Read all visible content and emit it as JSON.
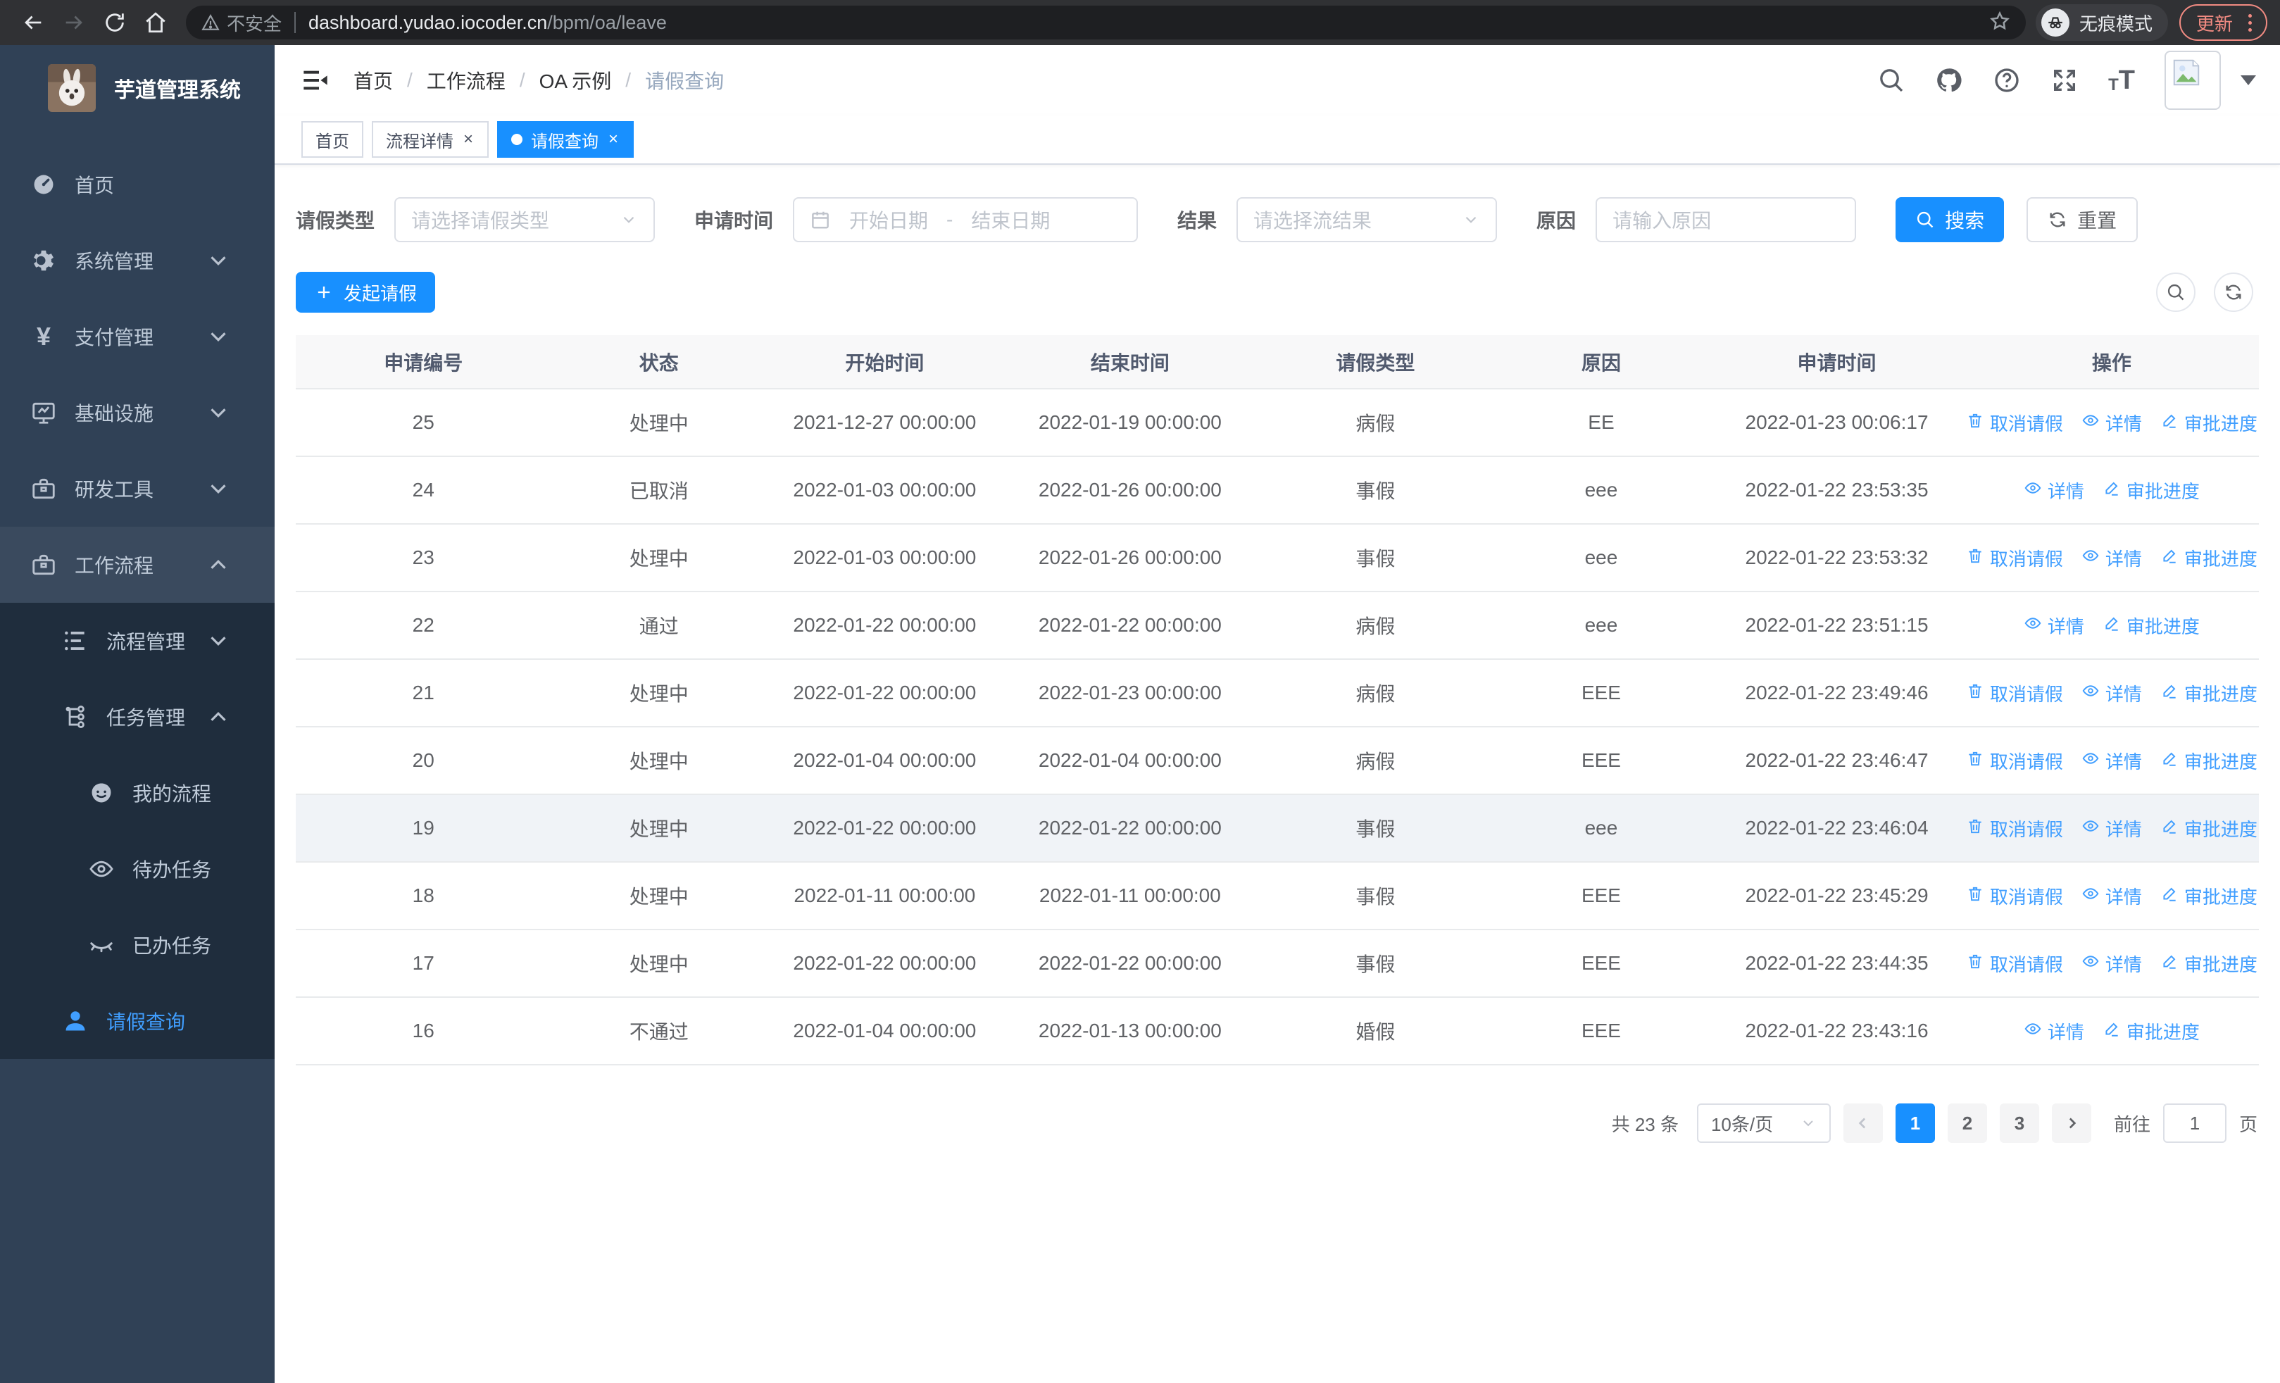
{
  "browser": {
    "security_label": "不安全",
    "url_host": "dashboard.yudao.iocoder.cn",
    "url_path": "/bpm/oa/leave",
    "incognito_label": "无痕模式",
    "update_label": "更新"
  },
  "sidebar": {
    "logo_title": "芋道管理系统",
    "items": [
      {
        "key": "home",
        "label": "首页",
        "icon": "dashboard-icon",
        "level": 1
      },
      {
        "key": "system",
        "label": "系统管理",
        "icon": "gear-icon",
        "level": 1,
        "chevron": "down"
      },
      {
        "key": "payment",
        "label": "支付管理",
        "icon": "yen-icon",
        "level": 1,
        "chevron": "down"
      },
      {
        "key": "infra",
        "label": "基础设施",
        "icon": "monitor-icon",
        "level": 1,
        "chevron": "down"
      },
      {
        "key": "dev-tools",
        "label": "研发工具",
        "icon": "toolbox-icon",
        "level": 1,
        "chevron": "down"
      },
      {
        "key": "workflow",
        "label": "工作流程",
        "icon": "briefcase-icon",
        "level": 1,
        "chevron": "up",
        "parent_active": true
      },
      {
        "key": "process-mgmt",
        "label": "流程管理",
        "icon": "list-icon",
        "level": 2,
        "chevron": "down",
        "dark": true
      },
      {
        "key": "task-mgmt",
        "label": "任务管理",
        "icon": "tree-icon",
        "level": 2,
        "chevron": "up",
        "dark": true
      },
      {
        "key": "my-process",
        "label": "我的流程",
        "icon": "face-icon",
        "level": 3,
        "dark": true
      },
      {
        "key": "todo-tasks",
        "label": "待办任务",
        "icon": "eye-open-icon",
        "level": 3,
        "dark": true
      },
      {
        "key": "done-tasks",
        "label": "已办任务",
        "icon": "eye-closed-icon",
        "level": 3,
        "dark": true
      },
      {
        "key": "leave-query",
        "label": "请假查询",
        "icon": "user-icon",
        "level": 2,
        "dark": true,
        "active": true
      }
    ]
  },
  "header": {
    "breadcrumb": [
      "首页",
      "工作流程",
      "OA 示例",
      "请假查询"
    ],
    "separator": "/"
  },
  "tabs": [
    {
      "label": "首页",
      "closable": false,
      "active": false
    },
    {
      "label": "流程详情",
      "closable": true,
      "active": false
    },
    {
      "label": "请假查询",
      "closable": true,
      "active": true
    }
  ],
  "filters": {
    "leave_type": {
      "label": "请假类型",
      "placeholder": "请选择请假类型"
    },
    "apply_time": {
      "label": "申请时间",
      "start_placeholder": "开始日期",
      "separator": "-",
      "end_placeholder": "结束日期"
    },
    "result": {
      "label": "结果",
      "placeholder": "请选择流结果"
    },
    "reason": {
      "label": "原因",
      "placeholder": "请输入原因"
    },
    "search_label": "搜索",
    "reset_label": "重置"
  },
  "toolbar": {
    "create_label": "发起请假"
  },
  "table": {
    "columns": [
      "申请编号",
      "状态",
      "开始时间",
      "结束时间",
      "请假类型",
      "原因",
      "申请时间",
      "操作"
    ],
    "action_labels": {
      "cancel": "取消请假",
      "detail": "详情",
      "progress": "审批进度"
    },
    "rows": [
      {
        "id": "25",
        "status": "处理中",
        "start": "2021-12-27 00:00:00",
        "end": "2022-01-19 00:00:00",
        "type": "病假",
        "reason": "EE",
        "apply": "2022-01-23 00:06:17",
        "cancellable": true,
        "highlight": false
      },
      {
        "id": "24",
        "status": "已取消",
        "start": "2022-01-03 00:00:00",
        "end": "2022-01-26 00:00:00",
        "type": "事假",
        "reason": "eee",
        "apply": "2022-01-22 23:53:35",
        "cancellable": false,
        "highlight": false
      },
      {
        "id": "23",
        "status": "处理中",
        "start": "2022-01-03 00:00:00",
        "end": "2022-01-26 00:00:00",
        "type": "事假",
        "reason": "eee",
        "apply": "2022-01-22 23:53:32",
        "cancellable": true,
        "highlight": false
      },
      {
        "id": "22",
        "status": "通过",
        "start": "2022-01-22 00:00:00",
        "end": "2022-01-22 00:00:00",
        "type": "病假",
        "reason": "eee",
        "apply": "2022-01-22 23:51:15",
        "cancellable": false,
        "highlight": false
      },
      {
        "id": "21",
        "status": "处理中",
        "start": "2022-01-22 00:00:00",
        "end": "2022-01-23 00:00:00",
        "type": "病假",
        "reason": "EEE",
        "apply": "2022-01-22 23:49:46",
        "cancellable": true,
        "highlight": false
      },
      {
        "id": "20",
        "status": "处理中",
        "start": "2022-01-04 00:00:00",
        "end": "2022-01-04 00:00:00",
        "type": "病假",
        "reason": "EEE",
        "apply": "2022-01-22 23:46:47",
        "cancellable": true,
        "highlight": false
      },
      {
        "id": "19",
        "status": "处理中",
        "start": "2022-01-22 00:00:00",
        "end": "2022-01-22 00:00:00",
        "type": "事假",
        "reason": "eee",
        "apply": "2022-01-22 23:46:04",
        "cancellable": true,
        "highlight": true
      },
      {
        "id": "18",
        "status": "处理中",
        "start": "2022-01-11 00:00:00",
        "end": "2022-01-11 00:00:00",
        "type": "事假",
        "reason": "EEE",
        "apply": "2022-01-22 23:45:29",
        "cancellable": true,
        "highlight": false
      },
      {
        "id": "17",
        "status": "处理中",
        "start": "2022-01-22 00:00:00",
        "end": "2022-01-22 00:00:00",
        "type": "事假",
        "reason": "EEE",
        "apply": "2022-01-22 23:44:35",
        "cancellable": true,
        "highlight": false
      },
      {
        "id": "16",
        "status": "不通过",
        "start": "2022-01-04 00:00:00",
        "end": "2022-01-13 00:00:00",
        "type": "婚假",
        "reason": "EEE",
        "apply": "2022-01-22 23:43:16",
        "cancellable": false,
        "highlight": false
      }
    ]
  },
  "pagination": {
    "total_label": "共 23 条",
    "page_size": "10条/页",
    "pages": [
      "1",
      "2",
      "3"
    ],
    "active_page": "1",
    "goto_label": "前往",
    "goto_value": "1",
    "page_label": "页"
  },
  "colors": {
    "primary": "#1890ff",
    "link": "#409eff",
    "sidebar_bg": "#304156",
    "sidebar_submenu_bg": "#1f2d3d",
    "sidebar_text": "#bfcbd9",
    "active_tab_bg": "#1890ff",
    "update_accent": "#f28b82",
    "table_header_bg": "#f8f8f9",
    "border": "#dcdfe6"
  }
}
